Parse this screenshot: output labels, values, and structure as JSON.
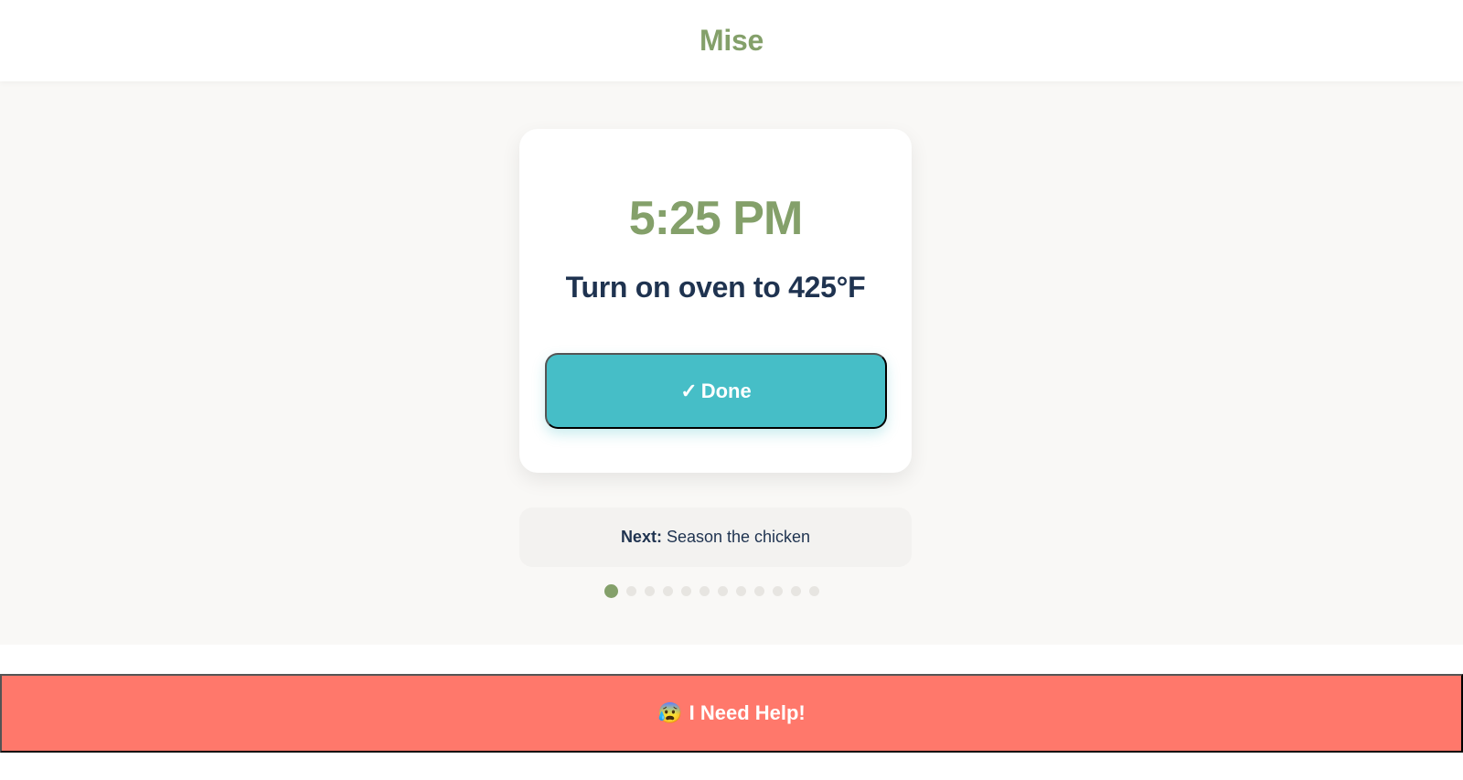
{
  "app": {
    "title": "Mise"
  },
  "colors": {
    "brand": "#84a06a",
    "done_button": "#46bec7",
    "help_button": "#ff786b",
    "heading_text": "#1f3350"
  },
  "current_step": {
    "time": "5:25 PM",
    "instruction": "Turn on oven to 425°F",
    "done_label": "Done",
    "done_icon": "check-icon",
    "done_icon_glyph": "✓"
  },
  "next_step": {
    "label": "Next:",
    "text": "Season the chicken"
  },
  "progress": {
    "current": 1,
    "total": 12
  },
  "help": {
    "label": "I Need Help!",
    "icon": "anxious-face-icon",
    "icon_glyph": "😰"
  }
}
